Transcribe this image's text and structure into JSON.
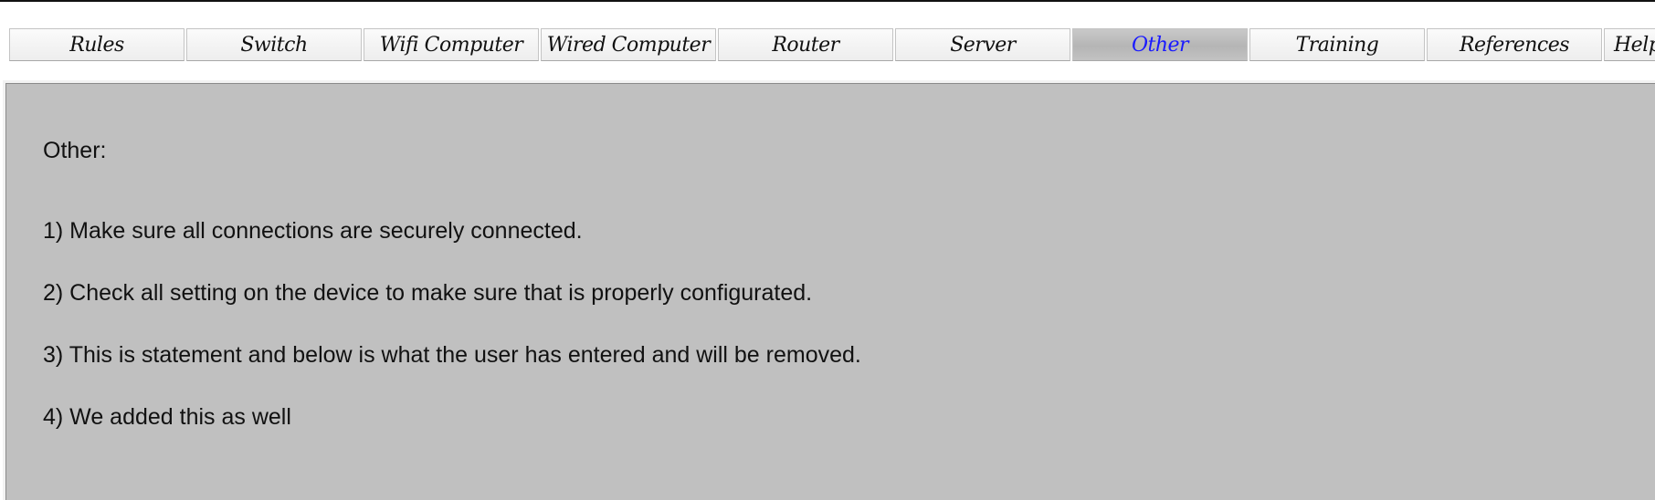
{
  "tabs": [
    {
      "label": "Rules"
    },
    {
      "label": "Switch"
    },
    {
      "label": "Wifi Computer"
    },
    {
      "label": "Wired Computer"
    },
    {
      "label": "Router"
    },
    {
      "label": "Server"
    },
    {
      "label": "Other"
    },
    {
      "label": "Training"
    },
    {
      "label": "References"
    },
    {
      "label": "Help"
    }
  ],
  "active_tab": "Other",
  "colors": {
    "active_tab_text": "#1a1aff",
    "panel_background": "#c0c0c0"
  },
  "panel": {
    "title": "Other:",
    "items": [
      "1) Make sure all connections are securely connected.",
      "2) Check all setting on the device to make sure that is properly configurated.",
      "3) This is statement and below is what the user has entered and will be removed.",
      "4) We added this as well"
    ]
  }
}
